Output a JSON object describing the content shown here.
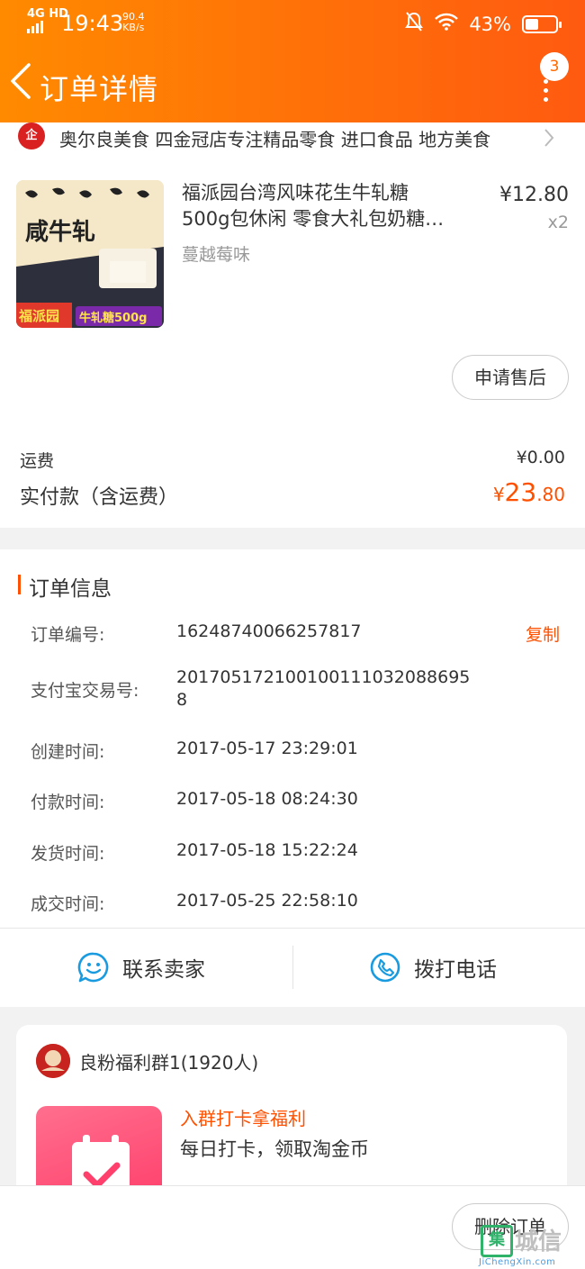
{
  "status_bar": {
    "network": "4G HD",
    "time": "19:43",
    "speed_value": "90.4",
    "speed_unit": "KB/s",
    "battery": "43%",
    "battery_level": 0.43
  },
  "header": {
    "title": "订单详情",
    "badge_count": "3"
  },
  "store": {
    "logo_text": "企",
    "name": "奥尔良美食 四金冠店专注精品零食 进口食品 地方美食"
  },
  "product": {
    "title_line1": "福派园台湾风味花生牛轧糖",
    "title_line2": "500g包休闲  零食大礼包奶糖…",
    "sku": "蔓越莓味",
    "price": "¥12.80",
    "qty": "x2",
    "image_brand": "福派园",
    "image_tag": "牛轧糖500g",
    "image_word": "咸牛轧"
  },
  "actions": {
    "after_sale": "申请售后",
    "delete_order": "删除订单"
  },
  "summary": {
    "shipping_label": "运费",
    "shipping_value": "¥0.00",
    "paid_label": "实付款（含运费）",
    "paid_currency": "¥",
    "paid_int": "23",
    "paid_dec": ".80",
    "accent_color": "#ff5000"
  },
  "order_info": {
    "section_title": "订单信息",
    "copy_label": "复制",
    "rows": [
      {
        "label": "订单编号:",
        "value": "16248740066257817"
      },
      {
        "label": "支付宝交易号:",
        "value": "201705172100100111032088695",
        "value_line2": "8"
      },
      {
        "label": "创建时间:",
        "value": "2017-05-17 23:29:01"
      },
      {
        "label": "付款时间:",
        "value": "2017-05-18 08:24:30"
      },
      {
        "label": "发货时间:",
        "value": "2017-05-18 15:22:24"
      },
      {
        "label": "成交时间:",
        "value": "2017-05-25 22:58:10"
      }
    ]
  },
  "contact": {
    "seller": "联系卖家",
    "phone": "拨打电话",
    "icon_color": "#1a9be0"
  },
  "group": {
    "name": "良粉福利群1(1920人)",
    "cta": "入群打卡拿福利",
    "desc": "每日打卡，领取淘金币"
  },
  "watermark": {
    "box": "集",
    "text": "城信",
    "url": "JiChengXin.com"
  }
}
